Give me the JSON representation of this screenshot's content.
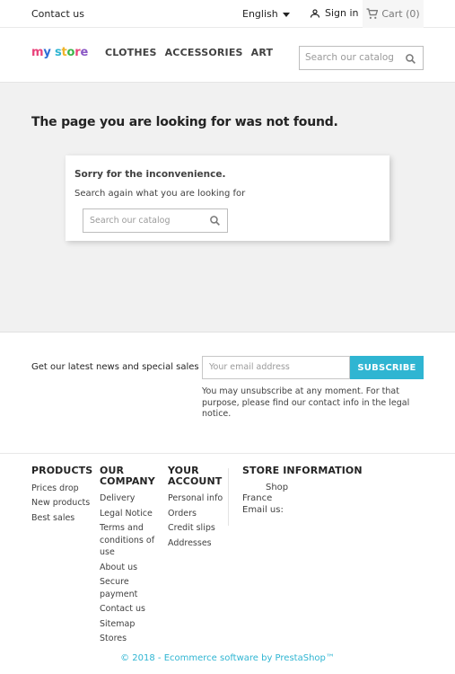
{
  "topbar": {
    "contact": "Contact us",
    "language": "English",
    "signin": "Sign in",
    "cart": "Cart (0)"
  },
  "header": {
    "logo": [
      "m",
      "y",
      " ",
      "s",
      "t",
      "o",
      "r",
      "e"
    ],
    "logo_colors": [
      "#e9427a",
      "#2b6cd6",
      "#ffffff",
      "#2fb5d2",
      "#f0b429",
      "#3bb54a",
      "#e9427a",
      "#8a57c5"
    ],
    "nav": [
      "CLOTHES",
      "ACCESSORIES",
      "ART"
    ],
    "search_placeholder": "Search our catalog"
  },
  "main": {
    "title": "The page you are looking for was not found.",
    "sorry": "Sorry for the inconvenience.",
    "search_again": "Search again what you are looking for",
    "search_placeholder": "Search our catalog"
  },
  "newsletter": {
    "label": "Get our latest news and special sales",
    "email_placeholder": "Your email address",
    "subscribe": "SUBSCRIBE",
    "note": "You may unsubscribe at any moment. For that purpose, please find our contact info in the legal notice."
  },
  "footer": {
    "products": {
      "title": "PRODUCTS",
      "links": [
        "Prices drop",
        "New products",
        "Best sales"
      ]
    },
    "company": {
      "title": "OUR COMPANY",
      "links": [
        "Delivery",
        "Legal Notice",
        "Terms and conditions of use",
        "About us",
        "Secure payment",
        "Contact us",
        "Sitemap",
        "Stores"
      ]
    },
    "account": {
      "title": "YOUR ACCOUNT",
      "links": [
        "Personal info",
        "Orders",
        "Credit slips",
        "Addresses"
      ]
    },
    "store": {
      "title": "STORE INFORMATION",
      "shop": "Shop",
      "country": "France",
      "email": "Email us:"
    },
    "copyright": "© 2018 - Ecommerce software by PrestaShop™"
  },
  "colors": {
    "accent": "#2fb5d2",
    "main_bg": "#f1f1f1"
  }
}
